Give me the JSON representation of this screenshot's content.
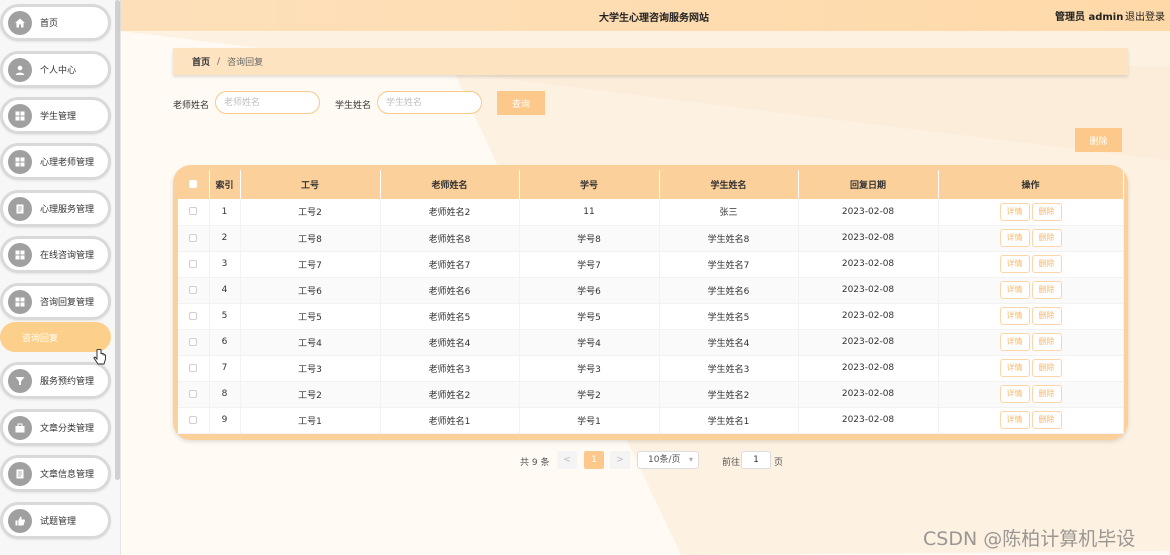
{
  "header": {
    "site_title": "大学生心理咨询服务网站",
    "admin_label": "管理员 admin",
    "logout": "退出登录"
  },
  "sidebar": {
    "items": [
      {
        "label": "首页",
        "icon": "home-icon"
      },
      {
        "label": "个人中心",
        "icon": "user-icon"
      },
      {
        "label": "学生管理",
        "icon": "grid-icon"
      },
      {
        "label": "心理老师管理",
        "icon": "grid-icon"
      },
      {
        "label": "心理服务管理",
        "icon": "document-icon"
      },
      {
        "label": "在线咨询管理",
        "icon": "grid-icon"
      },
      {
        "label": "咨询回复管理",
        "icon": "grid-icon"
      },
      {
        "label": "服务预约管理",
        "icon": "funnel-icon"
      },
      {
        "label": "文章分类管理",
        "icon": "briefcase-icon"
      },
      {
        "label": "文章信息管理",
        "icon": "document-icon"
      },
      {
        "label": "试题管理",
        "icon": "thumb-icon"
      }
    ],
    "submenu_active": "咨询回复"
  },
  "breadcrumb": {
    "home": "首页",
    "separator": "/",
    "current": "咨询回复"
  },
  "search": {
    "teacher_label": "老师姓名",
    "teacher_placeholder": "老师姓名",
    "student_label": "学生姓名",
    "student_placeholder": "学生姓名",
    "query_button": "查询"
  },
  "actions": {
    "delete_button": "删除"
  },
  "table": {
    "columns": [
      "索引",
      "工号",
      "老师姓名",
      "学号",
      "学生姓名",
      "回复日期",
      "操作"
    ],
    "detail_label": "详情",
    "delete_label": "删除",
    "rows": [
      {
        "index": "1",
        "job_no": "工号2",
        "teacher": "老师姓名2",
        "student_no": "11",
        "student": "张三",
        "date": "2023-02-08"
      },
      {
        "index": "2",
        "job_no": "工号8",
        "teacher": "老师姓名8",
        "student_no": "学号8",
        "student": "学生姓名8",
        "date": "2023-02-08"
      },
      {
        "index": "3",
        "job_no": "工号7",
        "teacher": "老师姓名7",
        "student_no": "学号7",
        "student": "学生姓名7",
        "date": "2023-02-08"
      },
      {
        "index": "4",
        "job_no": "工号6",
        "teacher": "老师姓名6",
        "student_no": "学号6",
        "student": "学生姓名6",
        "date": "2023-02-08"
      },
      {
        "index": "5",
        "job_no": "工号5",
        "teacher": "老师姓名5",
        "student_no": "学号5",
        "student": "学生姓名5",
        "date": "2023-02-08"
      },
      {
        "index": "6",
        "job_no": "工号4",
        "teacher": "老师姓名4",
        "student_no": "学号4",
        "student": "学生姓名4",
        "date": "2023-02-08"
      },
      {
        "index": "7",
        "job_no": "工号3",
        "teacher": "老师姓名3",
        "student_no": "学号3",
        "student": "学生姓名3",
        "date": "2023-02-08"
      },
      {
        "index": "8",
        "job_no": "工号2",
        "teacher": "老师姓名2",
        "student_no": "学号2",
        "student": "学生姓名2",
        "date": "2023-02-08"
      },
      {
        "index": "9",
        "job_no": "工号1",
        "teacher": "老师姓名1",
        "student_no": "学号1",
        "student": "学生姓名1",
        "date": "2023-02-08"
      }
    ]
  },
  "pagination": {
    "total": "共 9 条",
    "prev": "<",
    "current_page": "1",
    "next": ">",
    "page_size": "10条/页",
    "goto_label": "前往",
    "goto_value": "1",
    "page_suffix": "页"
  },
  "watermark": "CSDN @陈柏计算机毕设",
  "colors": {
    "accent": "#fcc98b",
    "header_bg": "#fde0ba",
    "table_header": "#fcd09a"
  }
}
